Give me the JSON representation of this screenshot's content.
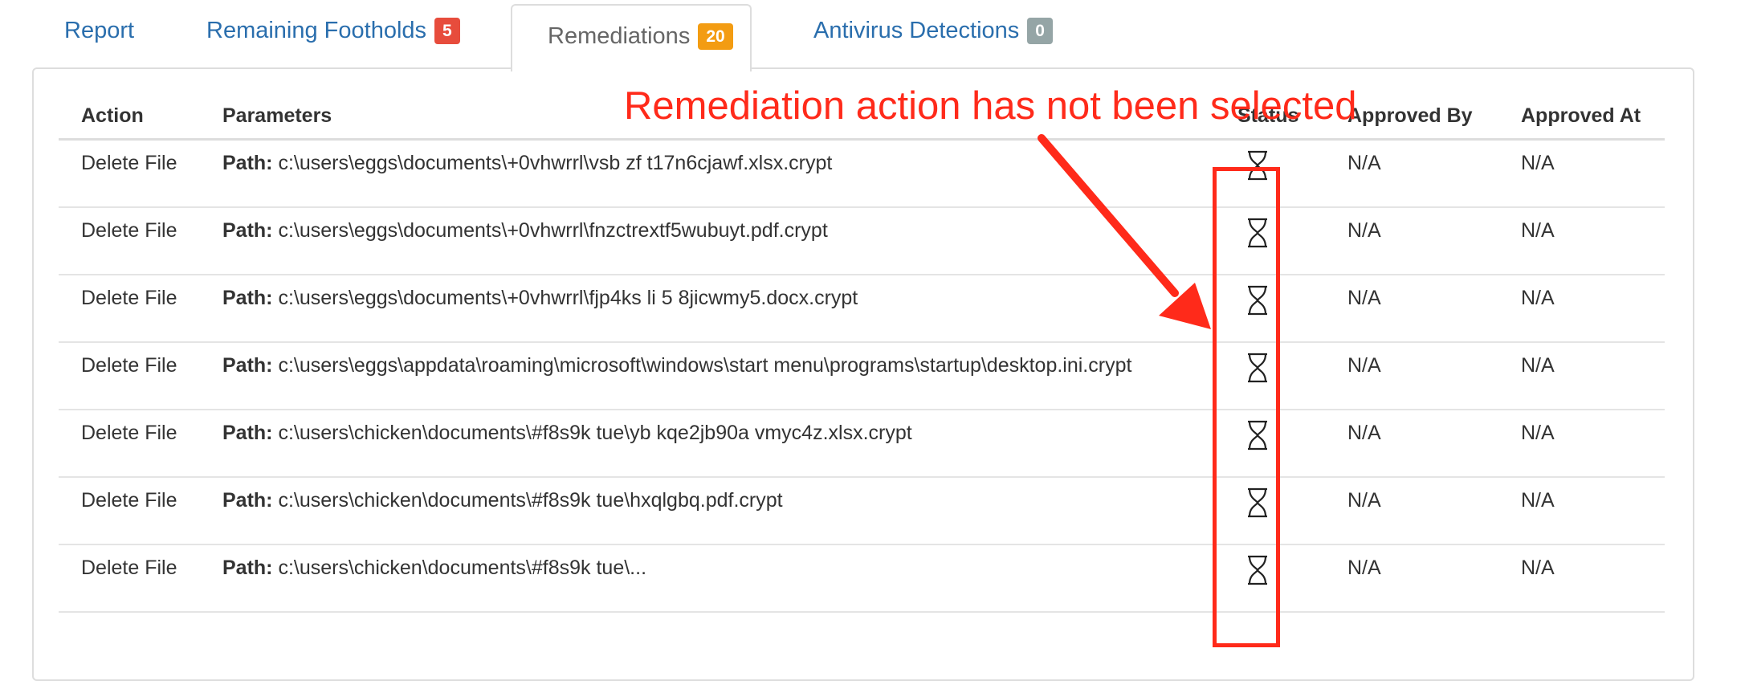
{
  "tabs": [
    {
      "label": "Report",
      "badge": null
    },
    {
      "label": "Remaining Footholds",
      "badge": "5",
      "badge_color": "#e74c3c"
    },
    {
      "label": "Remediations",
      "badge": "20",
      "badge_color": "#f39c12",
      "active": true
    },
    {
      "label": "Antivirus Detections",
      "badge": "0",
      "badge_color": "#95a5a6"
    }
  ],
  "table": {
    "headers": [
      "Action",
      "Parameters",
      "Status",
      "Approved By",
      "Approved At"
    ],
    "rows": [
      {
        "action": "Delete File",
        "param_label": "Path:",
        "param_value": "c:\\users\\eggs\\documents\\+0vhwrrl\\vsb zf t17n6cjawf.xlsx.crypt",
        "status_icon": "hourglass-icon",
        "approved_by": "N/A",
        "approved_at": "N/A"
      },
      {
        "action": "Delete File",
        "param_label": "Path:",
        "param_value": "c:\\users\\eggs\\documents\\+0vhwrrl\\fnzctrextf5wubuyt.pdf.crypt",
        "status_icon": "hourglass-icon",
        "approved_by": "N/A",
        "approved_at": "N/A"
      },
      {
        "action": "Delete File",
        "param_label": "Path:",
        "param_value": "c:\\users\\eggs\\documents\\+0vhwrrl\\fjp4ks li 5 8jicwmy5.docx.crypt",
        "status_icon": "hourglass-icon",
        "approved_by": "N/A",
        "approved_at": "N/A"
      },
      {
        "action": "Delete File",
        "param_label": "Path:",
        "param_value": "c:\\users\\eggs\\appdata\\roaming\\microsoft\\windows\\start menu\\programs\\startup\\desktop.ini.crypt",
        "status_icon": "hourglass-icon",
        "approved_by": "N/A",
        "approved_at": "N/A"
      },
      {
        "action": "Delete File",
        "param_label": "Path:",
        "param_value": "c:\\users\\chicken\\documents\\#f8s9k tue\\yb kqe2jb90a vmyc4z.xlsx.crypt",
        "status_icon": "hourglass-icon",
        "approved_by": "N/A",
        "approved_at": "N/A"
      },
      {
        "action": "Delete File",
        "param_label": "Path:",
        "param_value": "c:\\users\\chicken\\documents\\#f8s9k tue\\hxqlgbq.pdf.crypt",
        "status_icon": "hourglass-icon",
        "approved_by": "N/A",
        "approved_at": "N/A"
      },
      {
        "action": "Delete File",
        "param_label": "Path:",
        "param_value": "c:\\users\\chicken\\documents\\#f8s9k tue\\...",
        "status_icon": "hourglass-icon",
        "approved_by": "N/A",
        "approved_at": "N/A"
      }
    ]
  },
  "annotation": {
    "text": "Remediation action has not been selected",
    "color": "#ff2a1a"
  }
}
